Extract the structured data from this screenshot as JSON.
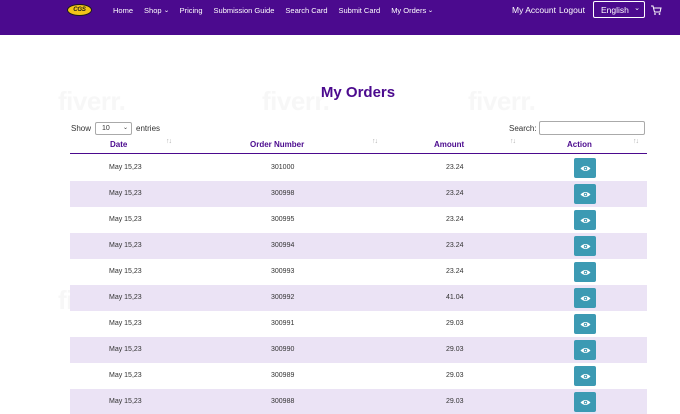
{
  "header": {
    "logo_text": "CGS",
    "nav": [
      {
        "label": "Home",
        "dropdown": false
      },
      {
        "label": "Shop",
        "dropdown": true
      },
      {
        "label": "Pricing",
        "dropdown": false
      },
      {
        "label": "Submission Guide",
        "dropdown": false
      },
      {
        "label": "Search Card",
        "dropdown": false
      },
      {
        "label": "Submit Card",
        "dropdown": false
      },
      {
        "label": "My Orders",
        "dropdown": true
      }
    ],
    "my_account": "My Account",
    "logout": "Logout",
    "language": "English",
    "cart_icon": "cart-icon"
  },
  "page": {
    "title": "My Orders",
    "show_label": "Show",
    "entries_value": "10",
    "entries_label": "entries",
    "search_label": "Search:",
    "search_value": ""
  },
  "table": {
    "columns": [
      "Date",
      "Order Number",
      "Amount",
      "Action"
    ],
    "rows": [
      {
        "date": "May 15,23",
        "order": "301000",
        "amount": "23.24"
      },
      {
        "date": "May 15,23",
        "order": "300998",
        "amount": "23.24"
      },
      {
        "date": "May 15,23",
        "order": "300995",
        "amount": "23.24"
      },
      {
        "date": "May 15,23",
        "order": "300994",
        "amount": "23.24"
      },
      {
        "date": "May 15,23",
        "order": "300993",
        "amount": "23.24"
      },
      {
        "date": "May 15,23",
        "order": "300992",
        "amount": "41.04"
      },
      {
        "date": "May 15,23",
        "order": "300991",
        "amount": "29.03"
      },
      {
        "date": "May 15,23",
        "order": "300990",
        "amount": "29.03"
      },
      {
        "date": "May 15,23",
        "order": "300989",
        "amount": "29.03"
      },
      {
        "date": "May 15,23",
        "order": "300988",
        "amount": "29.03"
      }
    ],
    "action_icon": "eye-icon"
  },
  "watermark": "fiverr.",
  "colors": {
    "brand": "#4b0a8e",
    "row_alt": "#ebe3f5",
    "action_button": "#3c9ab3"
  }
}
